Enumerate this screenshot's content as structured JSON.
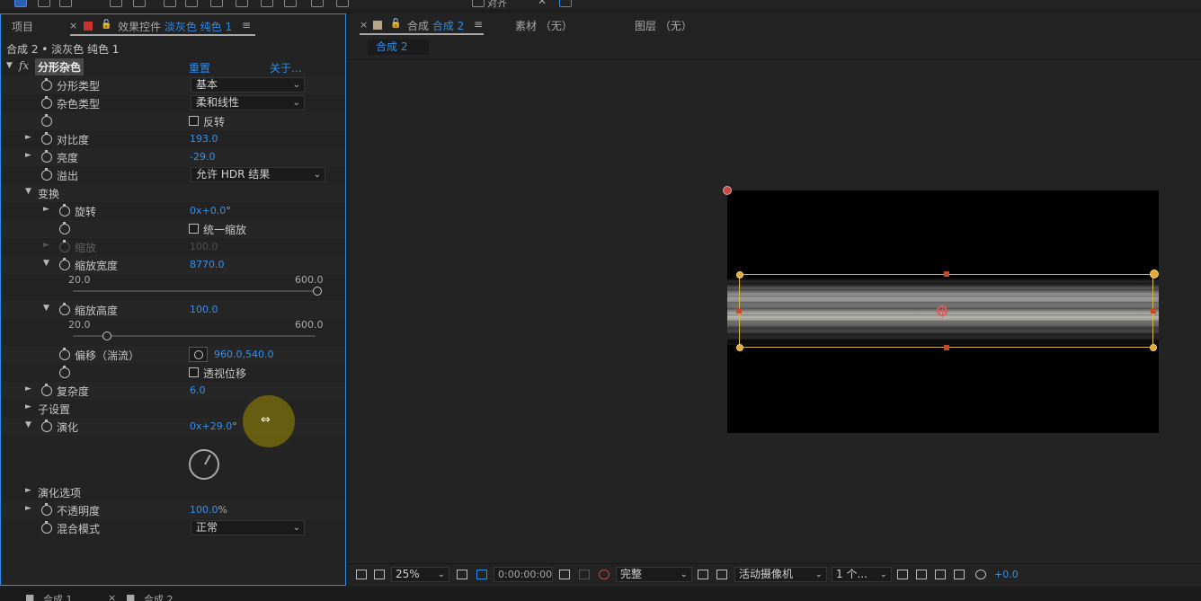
{
  "toolbar": {
    "snap_label": "对齐"
  },
  "left_panel": {
    "tab_project": "项目",
    "tab_effects_prefix": "效果控件",
    "tab_effects_layer": "淡灰色 纯色 1",
    "panel_subtitle": "合成 2 • 淡灰色 纯色 1",
    "effect": {
      "name": "分形杂色",
      "reset": "重置",
      "about": "关于..."
    },
    "props": {
      "fractal_type": {
        "label": "分形类型",
        "value": "基本"
      },
      "noise_type": {
        "label": "杂色类型",
        "value": "柔和线性"
      },
      "invert": {
        "label": "反转"
      },
      "contrast": {
        "label": "对比度",
        "value": "193.0"
      },
      "brightness": {
        "label": "亮度",
        "value": "-29.0"
      },
      "overflow": {
        "label": "溢出",
        "value": "允许 HDR 结果"
      },
      "transform": {
        "label": "变换"
      },
      "rotation": {
        "label": "旋转",
        "value": "0x+0.0",
        "unit": "°"
      },
      "uniform_scale": {
        "label": "统一缩放"
      },
      "scale": {
        "label": "缩放",
        "value": "100.0"
      },
      "scale_width": {
        "label": "缩放宽度",
        "value": "8770.0",
        "slider_min": "20.0",
        "slider_max": "600.0"
      },
      "scale_height": {
        "label": "缩放高度",
        "value": "100.0",
        "slider_min": "20.0",
        "slider_max": "600.0"
      },
      "offset": {
        "label": "偏移（湍流）",
        "value": "960.0,540.0"
      },
      "perspective_offset": {
        "label": "透视位移"
      },
      "complexity": {
        "label": "复杂度",
        "value": "6.0"
      },
      "sub_settings": {
        "label": "子设置"
      },
      "evolution": {
        "label": "演化",
        "value": "0x+29.0",
        "unit": "°"
      },
      "evolution_options": {
        "label": "演化选项"
      },
      "opacity": {
        "label": "不透明度",
        "value": "100.0",
        "unit": "%"
      },
      "blend_mode": {
        "label": "混合模式",
        "value": "正常"
      }
    }
  },
  "viewer": {
    "tab_comp_prefix": "合成",
    "tab_comp_name": "合成 2",
    "tab_footage": "素材 （无）",
    "tab_layer": "图层 （无）",
    "comp_tab_label": "合成 2",
    "bottom": {
      "zoom": "25%",
      "timecode": "0:00:00:00",
      "resolution": "完整",
      "camera": "活动摄像机",
      "views": "1 个...",
      "exposure": "+0.0"
    }
  },
  "bottom_strip": {
    "item1": "合成 1",
    "item2": "合成 2"
  },
  "colors": {
    "accent_blue": "#2d8ceb",
    "panel_bg": "#232323",
    "value_blue": "#3a8fe8"
  }
}
